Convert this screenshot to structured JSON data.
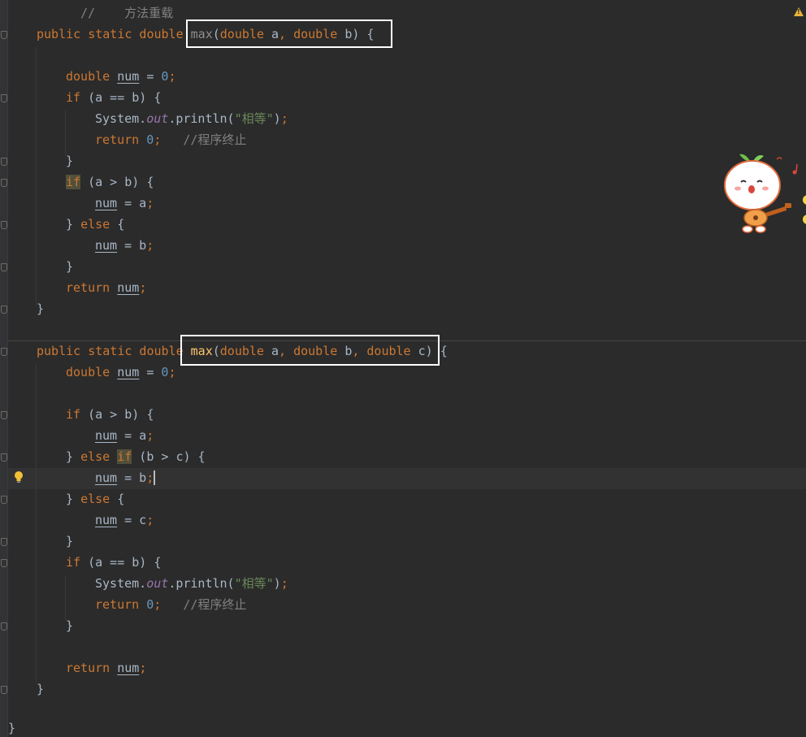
{
  "editor": {
    "lines": [
      {
        "tokens": [
          {
            "c": "cmt",
            "t": "//    方法重载"
          }
        ]
      },
      {
        "tokens": [
          {
            "c": "kw",
            "t": "public static double "
          },
          {
            "c": "fn-dim",
            "t": "max"
          },
          {
            "c": "",
            "t": "("
          },
          {
            "c": "kw",
            "t": "double "
          },
          {
            "c": "",
            "t": "a"
          },
          {
            "c": "kw",
            "t": ", double "
          },
          {
            "c": "",
            "t": "b) {"
          }
        ]
      },
      {
        "tokens": []
      },
      {
        "tokens": [
          {
            "c": "kw",
            "t": "double "
          },
          {
            "c": "var",
            "t": "num"
          },
          {
            "c": "",
            "t": " = "
          },
          {
            "c": "num",
            "t": "0"
          },
          {
            "c": "kw",
            "t": ";"
          }
        ]
      },
      {
        "tokens": [
          {
            "c": "kw",
            "t": "if "
          },
          {
            "c": "",
            "t": "(a == b) {"
          }
        ]
      },
      {
        "tokens": [
          {
            "c": "",
            "t": "System."
          },
          {
            "c": "fld",
            "t": "out"
          },
          {
            "c": "",
            "t": ".println("
          },
          {
            "c": "str",
            "t": "\"相等\""
          },
          {
            "c": "",
            "t": ")"
          },
          {
            "c": "kw",
            "t": ";"
          }
        ]
      },
      {
        "tokens": [
          {
            "c": "kw",
            "t": "return "
          },
          {
            "c": "num",
            "t": "0"
          },
          {
            "c": "kw",
            "t": ";   "
          },
          {
            "c": "cmt",
            "t": "//程序终止"
          }
        ]
      },
      {
        "tokens": [
          {
            "c": "",
            "t": "}"
          }
        ]
      },
      {
        "tokens": [
          {
            "c": "kw hl",
            "t": "if"
          },
          {
            "c": "",
            "t": " (a > b) {"
          }
        ]
      },
      {
        "tokens": [
          {
            "c": "var",
            "t": "num"
          },
          {
            "c": "",
            "t": " = a"
          },
          {
            "c": "kw",
            "t": ";"
          }
        ]
      },
      {
        "tokens": [
          {
            "c": "",
            "t": "} "
          },
          {
            "c": "kw",
            "t": "else "
          },
          {
            "c": "",
            "t": "{"
          }
        ]
      },
      {
        "tokens": [
          {
            "c": "var",
            "t": "num"
          },
          {
            "c": "",
            "t": " = b"
          },
          {
            "c": "kw",
            "t": ";"
          }
        ]
      },
      {
        "tokens": [
          {
            "c": "",
            "t": "}"
          }
        ]
      },
      {
        "tokens": [
          {
            "c": "kw",
            "t": "return "
          },
          {
            "c": "var",
            "t": "num"
          },
          {
            "c": "kw",
            "t": ";"
          }
        ]
      },
      {
        "tokens": [
          {
            "c": "",
            "t": "}"
          }
        ]
      },
      {
        "tokens": []
      },
      {
        "tokens": [
          {
            "c": "kw",
            "t": "public static double "
          },
          {
            "c": "fn",
            "t": "max"
          },
          {
            "c": "",
            "t": "("
          },
          {
            "c": "kw",
            "t": "double "
          },
          {
            "c": "",
            "t": "a"
          },
          {
            "c": "kw",
            "t": ", double "
          },
          {
            "c": "",
            "t": "b"
          },
          {
            "c": "kw",
            "t": ", double "
          },
          {
            "c": "",
            "t": "c) {"
          }
        ]
      },
      {
        "tokens": [
          {
            "c": "kw",
            "t": "double "
          },
          {
            "c": "var",
            "t": "num"
          },
          {
            "c": "",
            "t": " = "
          },
          {
            "c": "num",
            "t": "0"
          },
          {
            "c": "kw",
            "t": ";"
          }
        ]
      },
      {
        "tokens": []
      },
      {
        "tokens": [
          {
            "c": "kw",
            "t": "if "
          },
          {
            "c": "",
            "t": "(a > b) {"
          }
        ]
      },
      {
        "tokens": [
          {
            "c": "var",
            "t": "num"
          },
          {
            "c": "",
            "t": " = a"
          },
          {
            "c": "kw",
            "t": ";"
          }
        ]
      },
      {
        "tokens": [
          {
            "c": "",
            "t": "} "
          },
          {
            "c": "kw",
            "t": "else "
          },
          {
            "c": "kw hl",
            "t": "if"
          },
          {
            "c": "",
            "t": " (b > c) {"
          }
        ]
      },
      {
        "tokens": [
          {
            "c": "var",
            "t": "num"
          },
          {
            "c": "",
            "t": " = b"
          },
          {
            "c": "kw",
            "t": ";"
          }
        ],
        "caret": true
      },
      {
        "tokens": [
          {
            "c": "",
            "t": "} "
          },
          {
            "c": "kw",
            "t": "else "
          },
          {
            "c": "",
            "t": "{"
          }
        ]
      },
      {
        "tokens": [
          {
            "c": "var",
            "t": "num"
          },
          {
            "c": "",
            "t": " = c"
          },
          {
            "c": "kw",
            "t": ";"
          }
        ]
      },
      {
        "tokens": [
          {
            "c": "",
            "t": "}"
          }
        ]
      },
      {
        "tokens": [
          {
            "c": "kw",
            "t": "if "
          },
          {
            "c": "",
            "t": "(a == b) {"
          }
        ]
      },
      {
        "tokens": [
          {
            "c": "",
            "t": "System."
          },
          {
            "c": "fld",
            "t": "out"
          },
          {
            "c": "",
            "t": ".println("
          },
          {
            "c": "str",
            "t": "\"相等\""
          },
          {
            "c": "",
            "t": ")"
          },
          {
            "c": "kw",
            "t": ";"
          }
        ]
      },
      {
        "tokens": [
          {
            "c": "kw",
            "t": "return "
          },
          {
            "c": "num",
            "t": "0"
          },
          {
            "c": "kw",
            "t": ";   "
          },
          {
            "c": "cmt",
            "t": "//程序终止"
          }
        ]
      },
      {
        "tokens": [
          {
            "c": "",
            "t": "}"
          }
        ]
      },
      {
        "tokens": []
      },
      {
        "tokens": [
          {
            "c": "kw",
            "t": "return "
          },
          {
            "c": "var",
            "t": "num"
          },
          {
            "c": "kw",
            "t": ";"
          }
        ]
      },
      {
        "tokens": [
          {
            "c": "",
            "t": "}"
          }
        ]
      },
      {
        "tokens": []
      },
      {
        "tokens": [
          {
            "c": "",
            "t": "}"
          }
        ]
      }
    ]
  },
  "icons": {
    "warning": "warning-triangle-icon",
    "intention": "lightbulb-icon",
    "decoration": "cartoon-sticker"
  },
  "colors": {
    "background": "#2b2b2b",
    "keyword": "#cc7832",
    "number": "#6897bb",
    "string": "#6a8759",
    "comment": "#808080",
    "field": "#9876aa",
    "method": "#ffc66d",
    "text": "#a9b7c6"
  }
}
